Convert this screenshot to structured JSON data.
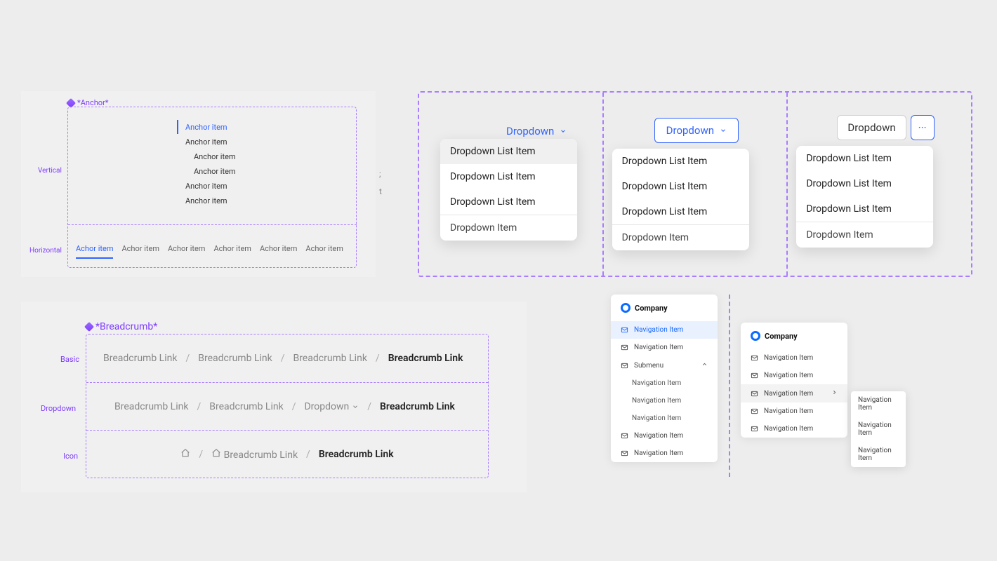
{
  "anchor": {
    "title": "*Anchor*",
    "labels": {
      "vertical": "Vertical",
      "horizontal": "Horizontal"
    },
    "vItems": [
      {
        "label": "Anchor item",
        "sub": false,
        "active": true
      },
      {
        "label": "Anchor item",
        "sub": false,
        "active": false
      },
      {
        "label": "Anchor item",
        "sub": true,
        "active": false
      },
      {
        "label": "Anchor item",
        "sub": true,
        "active": false
      },
      {
        "label": "Anchor item",
        "sub": false,
        "active": false
      },
      {
        "label": "Anchor item",
        "sub": false,
        "active": false
      }
    ],
    "hItems": [
      {
        "label": "Achor item",
        "active": true
      },
      {
        "label": "Achor item",
        "active": false
      },
      {
        "label": "Achor item",
        "active": false
      },
      {
        "label": "Achor item",
        "active": false
      },
      {
        "label": "Achor item",
        "active": false
      },
      {
        "label": "Achor item",
        "active": false
      }
    ],
    "ghost": {
      "l": ";",
      "t": "t"
    }
  },
  "dropdown": {
    "cells": [
      {
        "triggerType": "text",
        "triggerLabel": "Dropdown",
        "items": [
          "Dropdown List Item",
          "Dropdown List Item",
          "Dropdown List Item"
        ],
        "footer": "Dropdown Item",
        "hoverIndex": 0
      },
      {
        "triggerType": "outline",
        "triggerLabel": "Dropdown",
        "items": [
          "Dropdown List Item",
          "Dropdown List Item",
          "Dropdown List Item"
        ],
        "footer": "Dropdown Item",
        "hoverIndex": -1
      },
      {
        "triggerType": "split",
        "triggerLabel": "Dropdown",
        "moreGlyph": "···",
        "items": [
          "Dropdown List Item",
          "Dropdown List Item",
          "Dropdown List Item"
        ],
        "footer": "Dropdown Item",
        "hoverIndex": -1
      }
    ]
  },
  "breadcrumb": {
    "title": "*Breadcrumb*",
    "rowLabels": {
      "basic": "Basic",
      "dropdown": "Dropdown",
      "icon": "Icon"
    },
    "rows": {
      "basic": {
        "links": [
          "Breadcrumb Link",
          "Breadcrumb Link",
          "Breadcrumb Link"
        ],
        "current": "Breadcrumb Link"
      },
      "dropdown": {
        "links": [
          "Breadcrumb Link",
          "Breadcrumb Link"
        ],
        "dropdownLabel": "Dropdown",
        "current": "Breadcrumb Link"
      },
      "icon": {
        "iconLink": "Breadcrumb Link",
        "current": "Breadcrumb Link"
      }
    }
  },
  "nav": {
    "brand": "Company",
    "card1": {
      "items": [
        {
          "label": "Navigation Item",
          "active": true
        },
        {
          "label": "Navigation Item",
          "active": false
        }
      ],
      "submenu": {
        "label": "Submenu",
        "children": [
          "Navigation Item",
          "Navigation Item",
          "Navigation Item"
        ]
      },
      "rest": [
        "Navigation Item",
        "Navigation Item"
      ]
    },
    "card2": {
      "items": [
        {
          "label": "Navigation Item",
          "hover": false,
          "arrow": false
        },
        {
          "label": "Navigation Item",
          "hover": false,
          "arrow": false
        },
        {
          "label": "Navigation Item",
          "hover": true,
          "arrow": true
        },
        {
          "label": "Navigation Item",
          "hover": false,
          "arrow": false
        },
        {
          "label": "Navigation Item",
          "hover": false,
          "arrow": false
        }
      ]
    },
    "popup": [
      "Navigation Item",
      "Navigation Item",
      "Navigation Item"
    ]
  }
}
